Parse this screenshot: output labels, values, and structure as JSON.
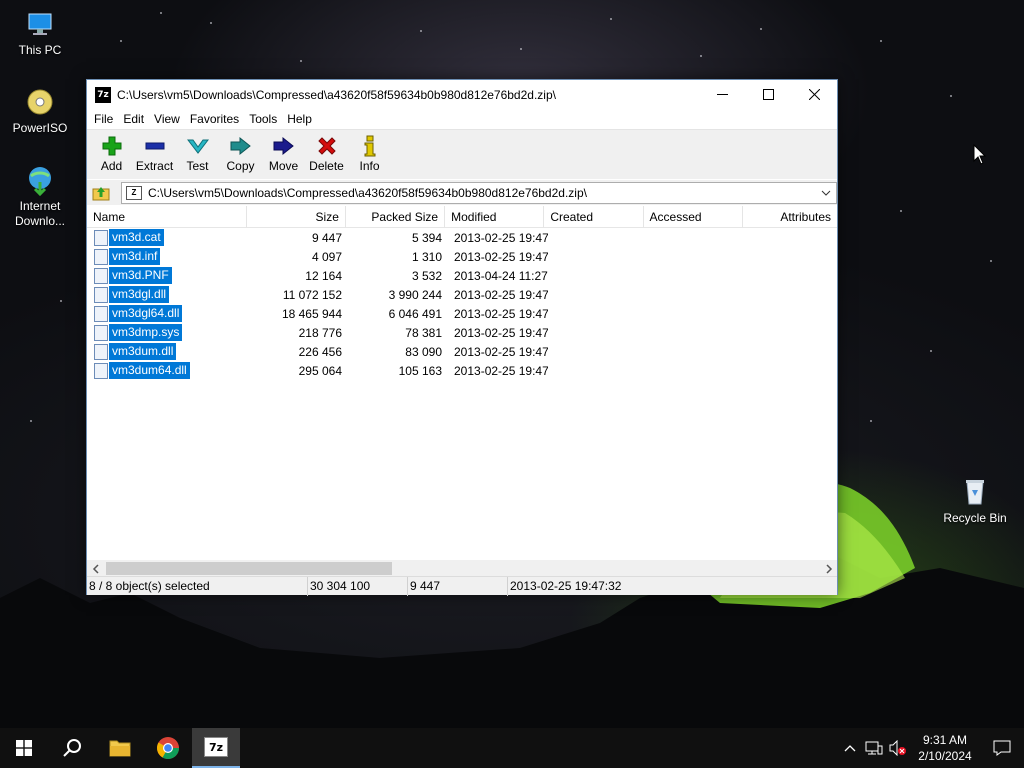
{
  "desktop": {
    "icons": [
      {
        "label": "This PC",
        "icon": "computer-icon"
      },
      {
        "label": "PowerISO",
        "icon": "disc-icon"
      },
      {
        "label": "Internet Downlo...",
        "icon": "globe-download-icon"
      },
      {
        "label": "Recycle Bin",
        "icon": "recycle-bin-icon"
      }
    ]
  },
  "window": {
    "app_icon_text": "7z",
    "title": "C:\\Users\\vm5\\Downloads\\Compressed\\a43620f58f59634b0b980d812e76bd2d.zip\\",
    "menu": [
      "File",
      "Edit",
      "View",
      "Favorites",
      "Tools",
      "Help"
    ],
    "toolbar": [
      {
        "label": "Add",
        "icon": "plus-icon",
        "color": "#19a319"
      },
      {
        "label": "Extract",
        "icon": "minus-icon",
        "color": "#1b2fa8"
      },
      {
        "label": "Test",
        "icon": "checkmark-icon",
        "color": "#27b6c4"
      },
      {
        "label": "Copy",
        "icon": "double-arrow-right-icon",
        "color": "#1f8c8c"
      },
      {
        "label": "Move",
        "icon": "arrow-right-icon",
        "color": "#1b1b8c"
      },
      {
        "label": "Delete",
        "icon": "x-icon",
        "color": "#d40d0d"
      },
      {
        "label": "Info",
        "icon": "info-icon",
        "color": "#c9b400"
      }
    ],
    "address": "C:\\Users\\vm5\\Downloads\\Compressed\\a43620f58f59634b0b980d812e76bd2d.zip\\",
    "columns": [
      "Name",
      "Size",
      "Packed Size",
      "Modified",
      "Created",
      "Accessed",
      "Attributes"
    ],
    "files": [
      {
        "name": "vm3d.cat",
        "size": "9 447",
        "packed": "5 394",
        "modified": "2013-02-25 19:47"
      },
      {
        "name": "vm3d.inf",
        "size": "4 097",
        "packed": "1 310",
        "modified": "2013-02-25 19:47"
      },
      {
        "name": "vm3d.PNF",
        "size": "12 164",
        "packed": "3 532",
        "modified": "2013-04-24 11:27"
      },
      {
        "name": "vm3dgl.dll",
        "size": "11 072 152",
        "packed": "3 990 244",
        "modified": "2013-02-25 19:47"
      },
      {
        "name": "vm3dgl64.dll",
        "size": "18 465 944",
        "packed": "6 046 491",
        "modified": "2013-02-25 19:47"
      },
      {
        "name": "vm3dmp.sys",
        "size": "218 776",
        "packed": "78 381",
        "modified": "2013-02-25 19:47"
      },
      {
        "name": "vm3dum.dll",
        "size": "226 456",
        "packed": "83 090",
        "modified": "2013-02-25 19:47"
      },
      {
        "name": "vm3dum64.dll",
        "size": "295 064",
        "packed": "105 163",
        "modified": "2013-02-25 19:47"
      }
    ],
    "status": {
      "selected": "8 / 8 object(s) selected",
      "total_size": "30 304 100",
      "packed": "9 447",
      "modified": "2013-02-25 19:47:32"
    }
  },
  "taskbar": {
    "pinned": [
      "start-icon",
      "search-icon",
      "file-explorer-icon",
      "chrome-icon",
      "7zip-icon"
    ],
    "active_app_text": "7z",
    "time": "9:31 AM",
    "date": "2/10/2024"
  }
}
